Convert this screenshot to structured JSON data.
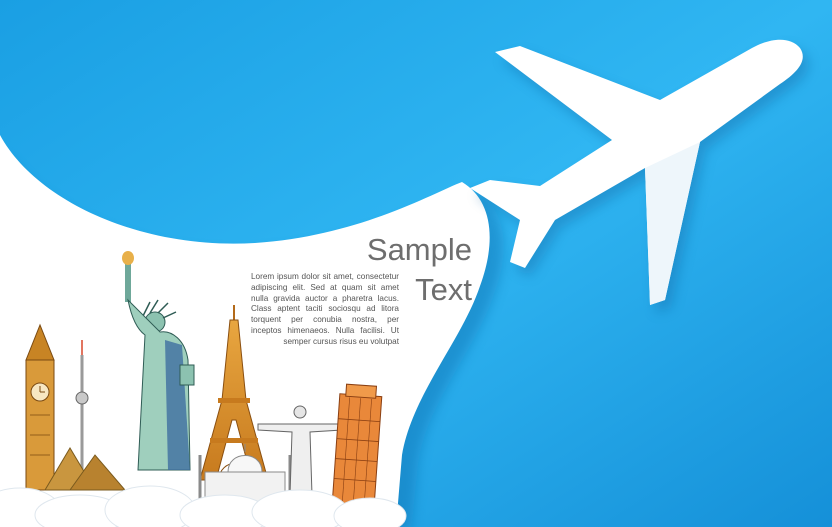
{
  "headline": {
    "line1": "Sample",
    "line2": "Text"
  },
  "body_text": "Lorem ipsum dolor sit amet, consectetur adipiscing elit. Sed at quam sit amet nulla gravida auctor a pharetra lacus. Class aptent taciti sociosqu ad litora torquent per conubia nostra, per inceptos himenaeos. Nulla facilisi. Ut semper cursus risus eu volutpat",
  "colors": {
    "sky_blue": "#1ba7ea",
    "sky_light": "#34b9f3",
    "paper_white": "#ffffff",
    "text_gray": "#6e6e6e"
  },
  "icons": [
    "airplane-icon",
    "big-ben-icon",
    "tv-tower-icon",
    "pyramids-icon",
    "statue-of-liberty-icon",
    "eiffel-tower-icon",
    "taj-mahal-icon",
    "christ-the-redeemer-icon",
    "leaning-tower-icon",
    "clouds-icon"
  ]
}
